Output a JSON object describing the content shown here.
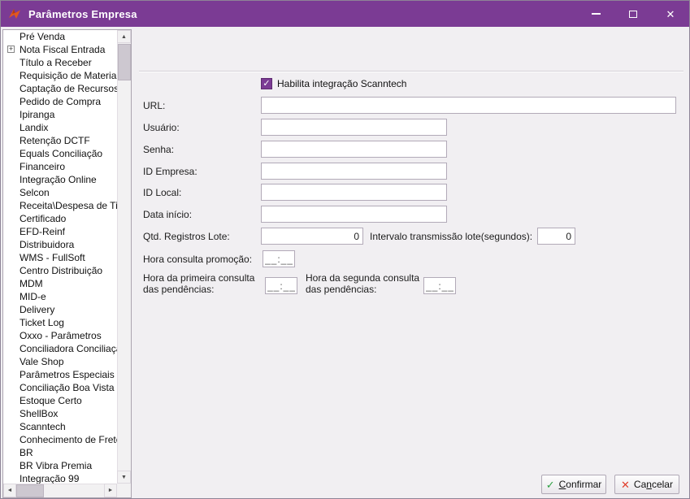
{
  "window": {
    "title": "Parâmetros Empresa"
  },
  "icons": {
    "check": "✓",
    "close": "✕",
    "arrow_up": "▲",
    "arrow_down": "▼",
    "arrow_left": "◄",
    "arrow_right": "►",
    "expand_plus": "+"
  },
  "colors": {
    "titlebar": "#7B3B94",
    "accent": "#7B3B94",
    "confirm_icon": "#2EA043",
    "cancel_icon": "#E03E2D"
  },
  "sidebar": {
    "items": [
      {
        "label": "Pré Venda"
      },
      {
        "label": "Nota Fiscal Entrada",
        "expandable": true
      },
      {
        "label": "Título a Receber"
      },
      {
        "label": "Requisição de Materiais"
      },
      {
        "label": "Captação de Recursos"
      },
      {
        "label": "Pedido de Compra"
      },
      {
        "label": "Ipiranga"
      },
      {
        "label": "Landix"
      },
      {
        "label": "Retenção DCTF"
      },
      {
        "label": "Equals Conciliação"
      },
      {
        "label": "Financeiro"
      },
      {
        "label": "Integração Online"
      },
      {
        "label": "Selcon"
      },
      {
        "label": "Receita\\Despesa de Titul"
      },
      {
        "label": "Certificado"
      },
      {
        "label": "EFD-Reinf"
      },
      {
        "label": "Distribuidora"
      },
      {
        "label": "WMS - FullSoft"
      },
      {
        "label": "Centro Distribuição"
      },
      {
        "label": "MDM"
      },
      {
        "label": "MID-e"
      },
      {
        "label": "Delivery"
      },
      {
        "label": "Ticket Log"
      },
      {
        "label": "Oxxo - Parâmetros"
      },
      {
        "label": "Conciliadora Conciliação"
      },
      {
        "label": "Vale Shop"
      },
      {
        "label": "Parâmetros Especiais"
      },
      {
        "label": "Conciliação Boa Vista"
      },
      {
        "label": "Estoque Certo"
      },
      {
        "label": "ShellBox"
      },
      {
        "label": "Scanntech"
      },
      {
        "label": "Conhecimento de Frete"
      },
      {
        "label": "BR"
      },
      {
        "label": "BR Vibra Premia"
      },
      {
        "label": "Integração 99"
      }
    ]
  },
  "form": {
    "enable_checkbox": {
      "label": "Habilita integração Scanntech",
      "checked": true
    },
    "url": {
      "label": "URL:",
      "value": ""
    },
    "usuario": {
      "label": "Usuário:",
      "value": ""
    },
    "senha": {
      "label": "Senha:",
      "value": ""
    },
    "id_empresa": {
      "label": "ID Empresa:",
      "value": ""
    },
    "id_local": {
      "label": "ID Local:",
      "value": ""
    },
    "data_inicio": {
      "label": "Data início:",
      "value": ""
    },
    "qtd_registros": {
      "label": "Qtd. Registros Lote:",
      "value": "0"
    },
    "intervalo": {
      "label": "Intervalo transmissão lote(segundos):",
      "value": "0"
    },
    "hora_promocao": {
      "label": "Hora consulta promoção:",
      "value": "__:__"
    },
    "hora_primeira": {
      "label_line1": "Hora da primeira consulta",
      "label_line2": "das pendências:",
      "value": "__:__"
    },
    "hora_segunda": {
      "label_line1": "Hora da segunda consulta",
      "label_line2": "das pendências:",
      "value": "__:__"
    }
  },
  "footer": {
    "confirm": {
      "pre": "",
      "accel": "C",
      "post": "onfirmar"
    },
    "cancel": {
      "pre": "Ca",
      "accel": "n",
      "post": "celar"
    }
  }
}
